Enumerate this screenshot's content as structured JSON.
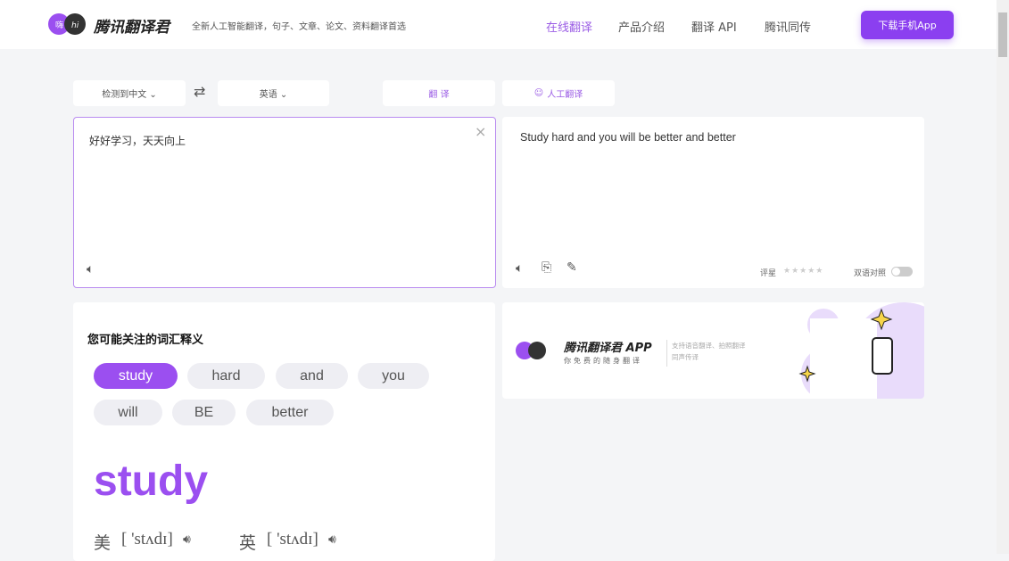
{
  "header": {
    "brand": "腾讯翻译君",
    "tagline": "全新人工智能翻译，句子、文章、论文、资料翻译首选",
    "nav": [
      "在线翻译",
      "产品介绍",
      "翻译 API",
      "腾讯同传"
    ],
    "download": "下载手机App",
    "accent": "#8b3ff0"
  },
  "toolbar": {
    "source_lang": "检测到中文 ⌄",
    "target_lang": "英语 ⌄",
    "translate": "翻 译",
    "human": "人工翻译"
  },
  "source": {
    "text": "好好学习，天天向上"
  },
  "output": {
    "text": "Study hard and you will be better and better",
    "rate_label": "评星",
    "bilingual_label": "双语对照",
    "bilingual_on": false,
    "rating": 0
  },
  "words": {
    "title": "您可能关注的词汇释义",
    "chips": [
      "study",
      "hard",
      "and",
      "you",
      "will",
      "BE",
      "better"
    ],
    "selected": "study",
    "us_label": "美",
    "us_phonetic": "[ 'stʌdɪ]",
    "uk_label": "英",
    "uk_phonetic": "[ 'stʌdɪ]"
  },
  "promo": {
    "title": "腾讯翻译君 APP",
    "subtitle": "你免费的随身翻译",
    "desc": "支持语音翻译、拍照翻译",
    "desc2": "同声传译"
  }
}
